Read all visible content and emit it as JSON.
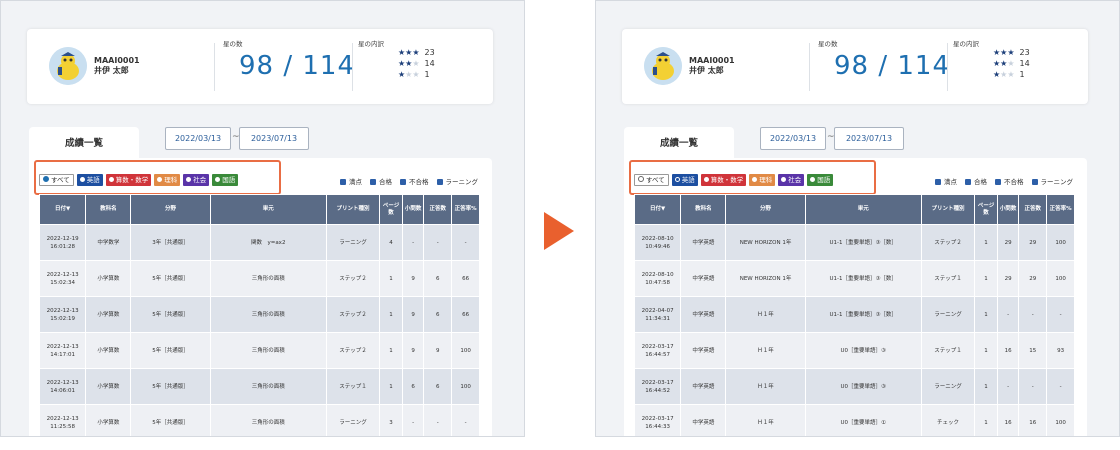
{
  "left": {
    "user": {
      "id": "MAAI0001",
      "name": "井伊 太郎"
    },
    "stars": {
      "label": "星の数",
      "count": "98 / 114"
    },
    "breakdown": {
      "label": "星の内訳",
      "rows": [
        {
          "filled": "★★★",
          "empty": "",
          "count": "23"
        },
        {
          "filled": "★★",
          "empty": "★",
          "count": "14"
        },
        {
          "filled": "★",
          "empty": "★★",
          "count": "1"
        }
      ]
    },
    "tab_label": "成績一覧",
    "date_from": "2022/03/13",
    "date_to": "2023/07/13",
    "filters": {
      "all": "すべて",
      "english": "英語",
      "math": "算数・数学",
      "science": "理科",
      "social": "社会",
      "japanese": "国語",
      "colors": {
        "english": "#1d4fa1",
        "math": "#d0343a",
        "science": "#e18a45",
        "social": "#5a34a8",
        "japanese": "#3a8a3a"
      }
    },
    "checks": [
      "満点",
      "合格",
      "不合格",
      "ラーニング"
    ],
    "columns": [
      "日付▼",
      "教科名",
      "分野",
      "単元",
      "プリント種別",
      "ページ数",
      "小問数",
      "正答数",
      "正答率%"
    ],
    "rows": [
      [
        "2022-12-19 16:01:28",
        "中学数学",
        "3年［共通版］",
        "関数　y=ax2",
        "ラーニング",
        "4",
        "-",
        "-",
        "-"
      ],
      [
        "2022-12-13 15:02:34",
        "小学算数",
        "5年［共通版］",
        "三角形の面積",
        "ステップ２",
        "1",
        "9",
        "6",
        "66"
      ],
      [
        "2022-12-13 15:02:19",
        "小学算数",
        "5年［共通版］",
        "三角形の面積",
        "ステップ２",
        "1",
        "9",
        "6",
        "66"
      ],
      [
        "2022-12-13 14:17:01",
        "小学算数",
        "5年［共通版］",
        "三角形の面積",
        "ステップ２",
        "1",
        "9",
        "9",
        "100"
      ],
      [
        "2022-12-13 14:06:01",
        "小学算数",
        "5年［共通版］",
        "三角形の面積",
        "ステップ１",
        "1",
        "6",
        "6",
        "100"
      ],
      [
        "2022-12-13 11:25:58",
        "小学算数",
        "5年［共通版］",
        "三角形の面積",
        "ラーニング",
        "3",
        "-",
        "-",
        "-"
      ]
    ]
  },
  "right": {
    "user": {
      "id": "MAAI0001",
      "name": "井伊 太郎"
    },
    "stars": {
      "label": "星の数",
      "count": "98 / 114"
    },
    "breakdown": {
      "label": "星の内訳",
      "rows": [
        {
          "filled": "★★★",
          "empty": "",
          "count": "23"
        },
        {
          "filled": "★★",
          "empty": "★",
          "count": "14"
        },
        {
          "filled": "★",
          "empty": "★★",
          "count": "1"
        }
      ]
    },
    "tab_label": "成績一覧",
    "date_from": "2022/03/13",
    "date_to": "2023/07/13",
    "filters": {
      "all": "すべて",
      "english": "英語",
      "math": "算数・数学",
      "science": "理科",
      "social": "社会",
      "japanese": "国語",
      "colors": {
        "english": "#1d4fa1",
        "math": "#d0343a",
        "science": "#e18a45",
        "social": "#5a34a8",
        "japanese": "#3a8a3a"
      }
    },
    "checks": [
      "満点",
      "合格",
      "不合格",
      "ラーニング"
    ],
    "columns": [
      "日付▼",
      "教科名",
      "分野",
      "単元",
      "プリント種別",
      "ページ数",
      "小問数",
      "正答数",
      "正答率%"
    ],
    "rows": [
      [
        "2022-08-10 10:49:46",
        "中学英語",
        "NEW HORIZON 1年",
        "U1-1［重要単語］③［数］",
        "ステップ２",
        "1",
        "29",
        "29",
        "100"
      ],
      [
        "2022-08-10 10:47:58",
        "中学英語",
        "NEW HORIZON 1年",
        "U1-1［重要単語］③［数］",
        "ステップ１",
        "1",
        "29",
        "29",
        "100"
      ],
      [
        "2022-04-07 11:34:31",
        "中学英語",
        "Ｈ１年",
        "U1-1［重要単語］③［数］",
        "ラーニング",
        "1",
        "-",
        "-",
        "-"
      ],
      [
        "2022-03-17 16:44:57",
        "中学英語",
        "Ｈ１年",
        "U0［重要単語］③",
        "ステップ１",
        "1",
        "16",
        "15",
        "93"
      ],
      [
        "2022-03-17 16:44:52",
        "中学英語",
        "Ｈ１年",
        "U0［重要単語］③",
        "ラーニング",
        "1",
        "-",
        "-",
        "-"
      ],
      [
        "2022-03-17 16:44:33",
        "中学英語",
        "Ｈ１年",
        "U0［重要単語］①",
        "チェック",
        "1",
        "16",
        "16",
        "100"
      ]
    ]
  }
}
